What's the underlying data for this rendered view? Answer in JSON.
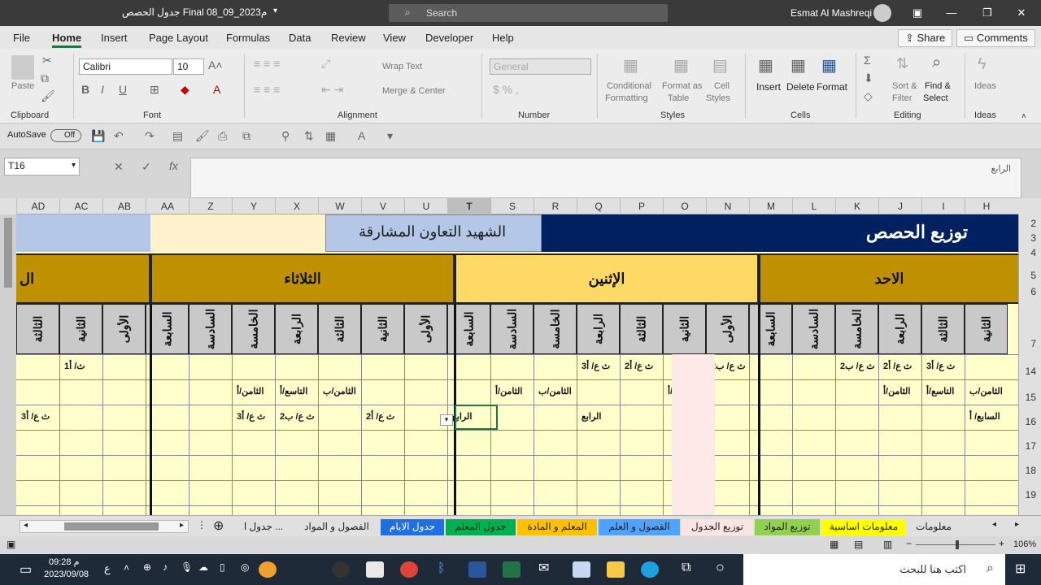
{
  "title": {
    "file": "جدول الحصص Final 08_09_2023م",
    "search": "Search",
    "user": "Esmat Al Mashreqi"
  },
  "menu": [
    "File",
    "Home",
    "Insert",
    "Page Layout",
    "Formulas",
    "Data",
    "Review",
    "View",
    "Developer",
    "Help"
  ],
  "menu_right": {
    "share": "Share",
    "comments": "Comments"
  },
  "ribbon": {
    "clipboard": {
      "paste": "Paste",
      "group": "Clipboard"
    },
    "font": {
      "name": "Calibri",
      "size": "10",
      "group": "Font"
    },
    "alignment": {
      "wrap": "Wrap Text",
      "merge": "Merge & Center",
      "group": "Alignment"
    },
    "number": {
      "format": "General",
      "group": "Number"
    },
    "styles": {
      "cond": "Conditional",
      "cond2": "Formatting",
      "fmt": "Format as",
      "fmt2": "Table",
      "cell": "Cell",
      "cell2": "Styles",
      "group": "Styles"
    },
    "cells": {
      "insert": "Insert",
      "delete": "Delete",
      "format": "Format",
      "group": "Cells"
    },
    "editing": {
      "sort": "Sort &",
      "sort2": "Filter",
      "find": "Find &",
      "find2": "Select",
      "group": "Editing"
    },
    "ideas": {
      "label": "Ideas",
      "group": "Ideas"
    }
  },
  "qat": {
    "autosave": "AutoSave",
    "toggle": "Off"
  },
  "formula_bar": {
    "cell_ref": "T16",
    "content": "الرابع"
  },
  "columns": [
    "AD",
    "AC",
    "AB",
    "AA",
    "Z",
    "Y",
    "X",
    "W",
    "V",
    "U",
    "T",
    "S",
    "R",
    "Q",
    "P",
    "O",
    "N",
    "M",
    "L",
    "K",
    "J",
    "I",
    "H"
  ],
  "selected_column": "T",
  "rows": [
    "2",
    "3",
    "4",
    "5",
    "6",
    "7",
    "14",
    "15",
    "16",
    "17",
    "18",
    "19"
  ],
  "sheet": {
    "school_title": "الشهيد التعاون المشارقة",
    "main_title": "توزيع الحصص",
    "days": {
      "sunday": "الاحد",
      "monday": "الإثنين",
      "tuesday": "الثلاثاء",
      "wednesday_partial": "ال"
    },
    "periods_sunday": [
      "الثانية",
      "الثالثة",
      "الرابعة",
      "الخامسة",
      "السادسة",
      "السابعة"
    ],
    "periods_monday": [
      "الأولى",
      "الثانية",
      "الثالثة",
      "الرابعة",
      "الخامسة",
      "السادسة",
      "السابعة"
    ],
    "periods_tuesday": [
      "الأولى",
      "الثانية",
      "الثالثة",
      "الرابعة",
      "الخامسة",
      "السادسة",
      "السابعة"
    ],
    "periods_wed": [
      "الأولى",
      "الثانية",
      "الثالثة"
    ],
    "row14": {
      "H": "",
      "I": "3ث ع/ أ",
      "J": "2ث ع/ أ",
      "K": "2ث ع/ ب",
      "M": "",
      "N": "2ث ع/ ب",
      "P": "2ث ع/ أ",
      "Q": "3ث ع/ أ",
      "AC": "1ث/ أ"
    },
    "row15": {
      "H": "الثامن/ب",
      "I": "التاسع/أ",
      "J": "الثامن/أ",
      "O": "التاسع/أ",
      "R": "الثامن/ب",
      "S": "الثامن/أ",
      "W": "الثامن/ب",
      "X": "التاسع/أ",
      "Y": "الثامن/أ"
    },
    "row16": {
      "H": "السابع/ أ",
      "Q": "الرابع",
      "T": "الرابع",
      "V": "2ث ع/ أ",
      "X": "2ث ع/ ب",
      "Y": "3ث ع/ أ",
      "AD": "3ث ع/ أ"
    }
  },
  "sheet_tabs": [
    "معلومات",
    "معلومات اساسية",
    "توزيع المواد",
    "توزيع الجدول",
    "الفصول و العلم",
    "المعلم و المادة",
    "جدول المعلم",
    "جدول الايام",
    "الفصول و المواد",
    "جدول ا ..."
  ],
  "status": {
    "zoom": "106%"
  },
  "taskbar": {
    "search": "اكتب هنا للبحث",
    "time": "09:28 م",
    "date": "2023/09/08",
    "lang": "ع"
  },
  "colors": {
    "navy": "#002060",
    "gold": "#bf9000",
    "light_gold": "#ffd966",
    "light_blue": "#b4c7e7",
    "cream": "#ffffcc",
    "excel_green": "#217346"
  }
}
